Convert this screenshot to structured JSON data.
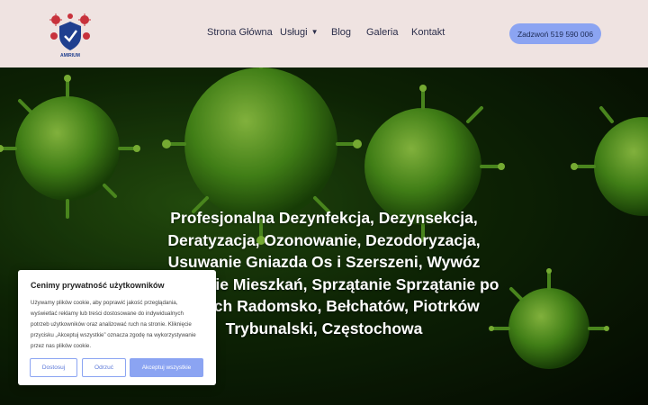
{
  "header": {
    "logo_text": "AMIRIUM",
    "nav": [
      {
        "label": "Strona Główna"
      },
      {
        "label": "Usługi",
        "has_dropdown": true
      },
      {
        "label": "Blog"
      },
      {
        "label": "Galeria"
      },
      {
        "label": "Kontakt"
      }
    ],
    "cta_label": "Zadzwoń 519 590 006"
  },
  "hero": {
    "title": "Profesjonalna Dezynfekcja, Dezynsekcja, Deratyzacja, Ozonowanie, Dezodoryzacja, Usuwanie Gniazda Os i Szerszeni, Wywóz Sprzątanie Mieszkań, Sprzątanie Sprzątanie po zgonach Radomsko, Bełchatów, Piotrków Trybunalski, Częstochowa"
  },
  "cookie": {
    "title": "Cenimy prywatność użytkowników",
    "text": "Używamy plików cookie, aby poprawić jakość przeglądania, wyświetlać reklamy lub treści dostosowane do indywidualnych potrzeb użytkowników oraz analizować ruch na stronie. Kliknięcie przycisku „Akceptuj wszystkie” oznacza zgodę na wykorzystywanie przez nas plików cookie.",
    "btn_customize": "Dostosuj",
    "btn_reject": "Odrzuć",
    "btn_accept": "Akceptuj wszystkie"
  },
  "colors": {
    "header_bg": "#efe3e1",
    "accent": "#8ba4f2",
    "nav_text": "#2b2e4a"
  }
}
